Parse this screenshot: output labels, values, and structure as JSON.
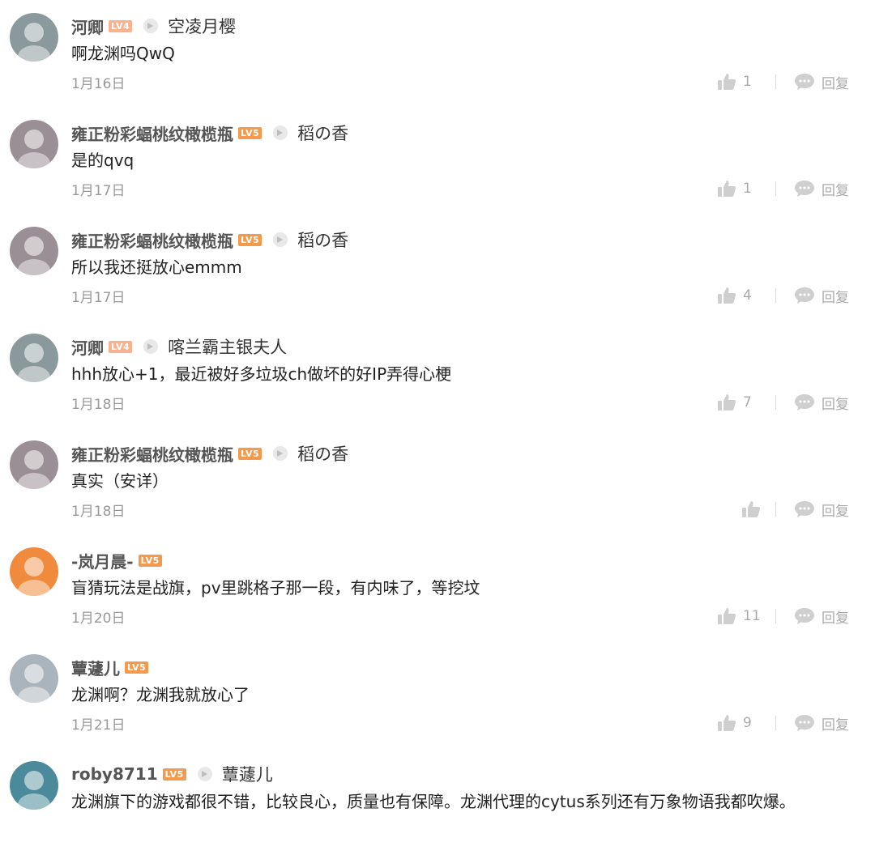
{
  "comments": [
    {
      "user": "河卿",
      "level": "LV4",
      "level_color": "#f7b38f",
      "reply_to": "空凌月樱",
      "text": "啊龙渊吗QwQ",
      "date": "1月16日",
      "likes": "1",
      "reply_label": "回复",
      "avatar_color": "#8a9a9c"
    },
    {
      "user": "雍正粉彩蝠桃纹橄榄瓶",
      "level": "LV5",
      "level_color": "#f59a4c",
      "reply_to": "稻の香",
      "text": "是的qvq",
      "date": "1月17日",
      "likes": "1",
      "reply_label": "回复",
      "avatar_color": "#9b8f96"
    },
    {
      "user": "雍正粉彩蝠桃纹橄榄瓶",
      "level": "LV5",
      "level_color": "#f59a4c",
      "reply_to": "稻の香",
      "text": "所以我还挺放心emmm",
      "date": "1月17日",
      "likes": "4",
      "reply_label": "回复",
      "avatar_color": "#9b8f96"
    },
    {
      "user": "河卿",
      "level": "LV4",
      "level_color": "#f7b38f",
      "reply_to": "喀兰霸主银夫人",
      "text": "hhh放心+1，最近被好多垃圾ch做坏的好IP弄得心梗",
      "date": "1月18日",
      "likes": "7",
      "reply_label": "回复",
      "avatar_color": "#8a9a9c"
    },
    {
      "user": "雍正粉彩蝠桃纹橄榄瓶",
      "level": "LV5",
      "level_color": "#f59a4c",
      "reply_to": "稻の香",
      "text": "真实（安详）",
      "date": "1月18日",
      "likes": "",
      "reply_label": "回复",
      "avatar_color": "#9b8f96"
    },
    {
      "user": "-岚月晨-",
      "level": "LV5",
      "level_color": "#f59a4c",
      "reply_to": "",
      "text": "盲猜玩法是战旗，pv里跳格子那一段，有内味了，等挖坟",
      "date": "1月20日",
      "likes": "11",
      "reply_label": "回复",
      "avatar_color": "#f08a3c"
    },
    {
      "user": "蕈蘧儿",
      "level": "LV5",
      "level_color": "#f59a4c",
      "reply_to": "",
      "text": "龙渊啊？龙渊我就放心了",
      "date": "1月21日",
      "likes": "9",
      "reply_label": "回复",
      "avatar_color": "#aab4bc"
    },
    {
      "user": "roby8711",
      "level": "LV5",
      "level_color": "#f59a4c",
      "reply_to": "蕈蘧儿",
      "text": "龙渊旗下的游戏都很不错，比较良心，质量也有保障。龙渊代理的cytus系列还有万象物语我都吹爆。",
      "date": "",
      "likes": "",
      "reply_label": "",
      "avatar_color": "#4a8a9a"
    }
  ]
}
